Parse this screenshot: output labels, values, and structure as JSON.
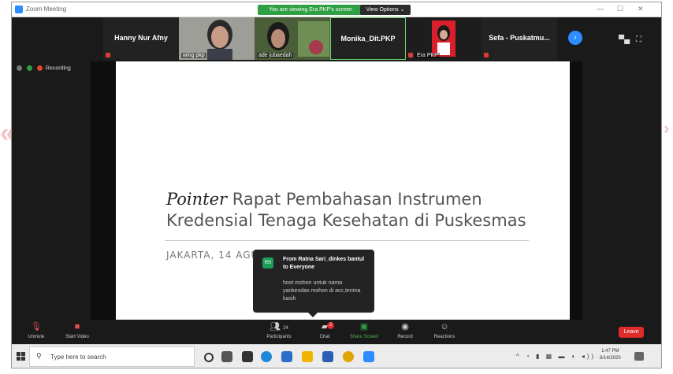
{
  "window": {
    "title": "Zoom Meeting",
    "viewing_banner": "You are viewing Era PKP's screen",
    "view_options": "View Options ⌄"
  },
  "participants": [
    {
      "name": "Hanny Nur Afny",
      "label": ""
    },
    {
      "name": "",
      "label": "wing pkp"
    },
    {
      "name": "",
      "label": "ade jubaedah"
    },
    {
      "name": "Monika_Dit.PKP",
      "label": ""
    },
    {
      "name": "",
      "label": "Era PKP"
    },
    {
      "name": "Sefa - Puskatmu...",
      "label": ""
    }
  ],
  "status": {
    "recording": "Recording"
  },
  "slide": {
    "title_italic": "Pointer",
    "title_line1": " Rapat Pembahasan Instrumen",
    "title_line2": "Kredensial Tenaga Kesehatan di Puskesmas",
    "subtitle": "JAKARTA, 14 AGUSTUS 2020"
  },
  "chat_popup": {
    "initials": "RS",
    "from": "From Ratna Sari_dinkes bantul to Everyone",
    "message": "host mohon untuk nama yankesdas mohon di acc,terima kasih"
  },
  "toolbar": {
    "unmute": "Unmute",
    "start_video": "Start Video",
    "participants": "Participants",
    "participants_count": "24",
    "chat": "Chat",
    "chat_badge": "2",
    "share_screen": "Share Screen",
    "record": "Record",
    "reactions": "Reactions",
    "leave": "Leave"
  },
  "taskbar": {
    "search_placeholder": "Type here to search",
    "time": "1:47 PM",
    "date": "8/14/2020"
  },
  "colors": {
    "zoom_blue": "#2d8cff",
    "share_green": "#2ea043",
    "leave_red": "#e02b2b"
  }
}
